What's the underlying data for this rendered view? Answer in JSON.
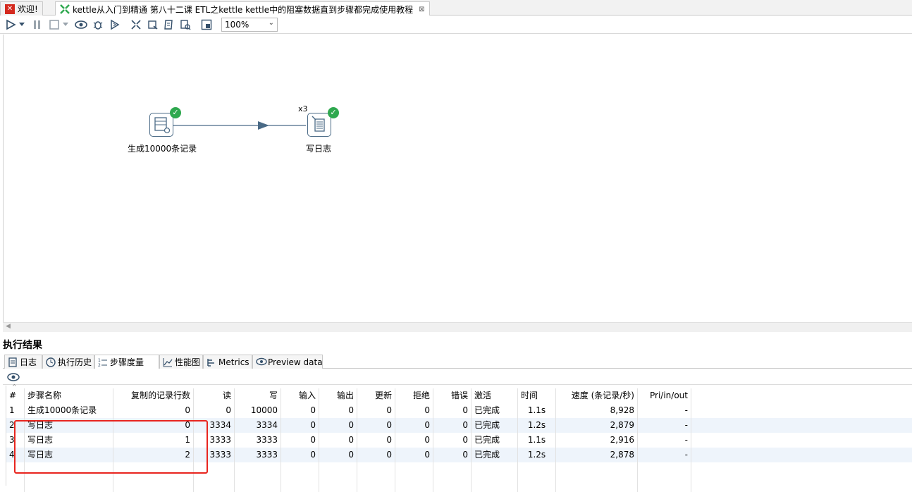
{
  "tabs": [
    {
      "label": "欢迎!",
      "icon": "pentaho-welcome-icon"
    },
    {
      "label": "kettle从入门到精通 第八十二课 ETL之kettle kettle中的阻塞数据直到步骤都完成使用教程",
      "icon": "transformation-icon",
      "close": "⊠"
    }
  ],
  "toolbar": {
    "zoom": "100%"
  },
  "canvas": {
    "steps": [
      {
        "label": "生成10000条记录",
        "icon": "generate-rows-icon"
      },
      {
        "label": "写日志",
        "icon": "write-log-icon",
        "copies": "x3"
      }
    ]
  },
  "results": {
    "title": "执行结果",
    "tabs": [
      {
        "label": "日志",
        "icon": "log-icon"
      },
      {
        "label": "执行历史",
        "icon": "history-icon"
      },
      {
        "label": "步骤度量",
        "icon": "step-metrics-icon"
      },
      {
        "label": "性能图",
        "icon": "performance-chart-icon"
      },
      {
        "label": "Metrics",
        "icon": "metrics-icon"
      },
      {
        "label": "Preview data",
        "icon": "preview-eye-icon"
      }
    ],
    "columns": [
      "#",
      "步骤名称",
      "复制的记录行数",
      "读",
      "写",
      "输入",
      "输出",
      "更新",
      "拒绝",
      "错误",
      "激活",
      "时间",
      "速度 (条记录/秒)",
      "Pri/in/out"
    ],
    "rows": [
      [
        "1",
        "生成10000条记录",
        "0",
        "0",
        "10000",
        "0",
        "0",
        "0",
        "0",
        "0",
        "已完成",
        "1.1s",
        "8,928",
        "-"
      ],
      [
        "2",
        "写日志",
        "0",
        "3334",
        "3334",
        "0",
        "0",
        "0",
        "0",
        "0",
        "已完成",
        "1.2s",
        "2,879",
        "-"
      ],
      [
        "3",
        "写日志",
        "1",
        "3333",
        "3333",
        "0",
        "0",
        "0",
        "0",
        "0",
        "已完成",
        "1.1s",
        "2,916",
        "-"
      ],
      [
        "4",
        "写日志",
        "2",
        "3333",
        "3333",
        "0",
        "0",
        "0",
        "0",
        "0",
        "已完成",
        "1.2s",
        "2,878",
        "-"
      ]
    ]
  },
  "colors": {
    "success": "#2fa84f",
    "hop": "#4a6a86",
    "highlight": "#e8251f",
    "row_alt": "#eef4fb"
  }
}
